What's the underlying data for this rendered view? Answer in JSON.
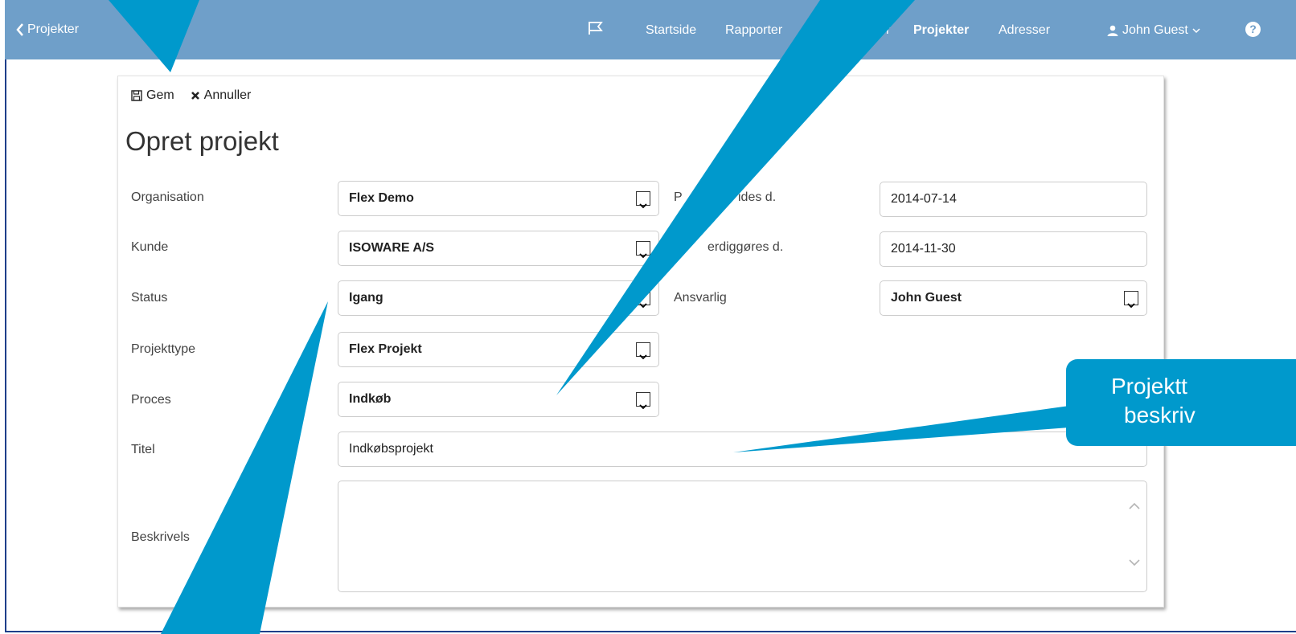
{
  "nav": {
    "back_label": "Projekter",
    "items": [
      {
        "label": "Startside",
        "active": false
      },
      {
        "label": "Rapporter",
        "active": false
      },
      {
        "label": "r",
        "active": false
      },
      {
        "label": "Projekter",
        "active": true
      },
      {
        "label": "Adresser",
        "active": false
      }
    ],
    "user_name": "John Guest",
    "help_icon": "?"
  },
  "toolbar": {
    "save_label": "Gem",
    "cancel_label": "Annuller"
  },
  "form": {
    "title": "Opret projekt",
    "organisation": {
      "label": "Organisation",
      "value": "Flex Demo"
    },
    "kunde": {
      "label": "Kunde",
      "value": "ISOWARE A/S"
    },
    "status": {
      "label": "Status",
      "value": "Igang"
    },
    "projekttype": {
      "label": "Projekttype",
      "value": "Flex Projekt"
    },
    "proces": {
      "label": "Proces",
      "value": "Indkøb"
    },
    "titel": {
      "label": "Titel",
      "value": "Indkøbsprojekt"
    },
    "beskrivelse": {
      "label": "Beskrivels",
      "value": ""
    },
    "start": {
      "label": "P",
      "label_rest": "ides d.",
      "value": "2014-07-14"
    },
    "slut": {
      "label": "erdiggøres d.",
      "value": "2014-11-30"
    },
    "ansvarlig": {
      "label": "Ansvarlig",
      "value": "John Guest"
    }
  },
  "callout": {
    "line1": "Projektt",
    "line2": "beskriv"
  },
  "colors": {
    "navbar": "#6f9fc9",
    "callout": "#0099cc",
    "frame": "#1e3f8a"
  },
  "icons": [
    "chevron-left-icon",
    "flag-icon",
    "user-icon",
    "chevron-down-icon",
    "help-icon",
    "save-icon",
    "close-icon"
  ]
}
